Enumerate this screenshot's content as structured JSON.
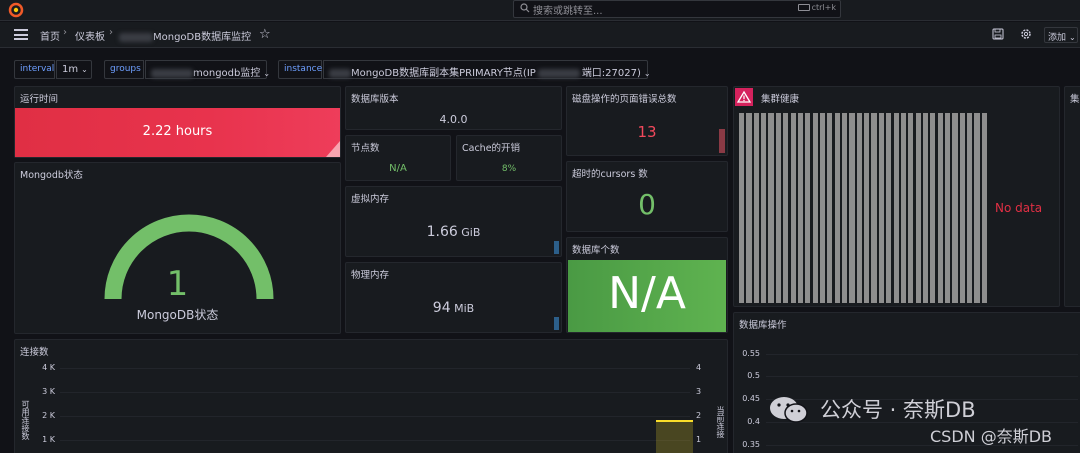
{
  "search": {
    "placeholder": "搜索或跳转至...",
    "shortcut": "ctrl+k"
  },
  "breadcrumb": {
    "home": "首页",
    "dashboards": "仪表板",
    "current": "MongoDB数据库监控"
  },
  "toolbar": {
    "add_label": "添加"
  },
  "variables": [
    {
      "label": "interval",
      "value": "1m"
    },
    {
      "label": "groups",
      "value": "mongodb监控"
    },
    {
      "label": "instance",
      "value": "MongoDB数据库副本集PRIMARY节点(IP",
      "value_suffix": "端口:27027)"
    }
  ],
  "panels": {
    "uptime": {
      "title": "运行时间",
      "value": "2.22 hours"
    },
    "db_version": {
      "title": "数据库版本",
      "value": "4.0.0"
    },
    "disk_page_faults": {
      "title": "磁盘操作的页面错误总数",
      "value": "13"
    },
    "cluster_health": {
      "title": "集群健康",
      "no_data": "No data",
      "bar_count": 34
    },
    "nodes": {
      "title": "节点数",
      "value": "N/A"
    },
    "cache_overhead": {
      "title": "Cache的开销",
      "value": "8%"
    },
    "mongodb_status": {
      "title": "Mongodb状态",
      "value": "1",
      "caption": "MongoDB状态",
      "gauge_fraction": 1.0
    },
    "virtual_mem": {
      "title": "虚拟内存",
      "value": "1.66",
      "unit": "GiB"
    },
    "cursors_timeout": {
      "title": "超时的cursors 数",
      "value": "0"
    },
    "physical_mem": {
      "title": "物理内存",
      "value": "94",
      "unit": "MiB"
    },
    "db_count": {
      "title": "数据库个数",
      "value": "N/A"
    },
    "connections": {
      "title": "连接数",
      "left_axis_label": "可用连接数",
      "right_axis_label": "当前连接",
      "left_ticks": [
        "4 K",
        "3 K",
        "2 K",
        "1 K"
      ],
      "right_ticks": [
        "4",
        "3",
        "2",
        "1"
      ]
    },
    "db_ops": {
      "title": "数据库操作",
      "ticks": [
        "0.55",
        "0.5",
        "0.45",
        "0.4",
        "0.35"
      ]
    },
    "partial_right": {
      "title": "集"
    }
  },
  "watermark": {
    "line1": "公众号 · 奈斯DB",
    "line2": "CSDN @奈斯DB"
  },
  "colors": {
    "uptime_bg": "#e02f44",
    "db_count_bg": "#56a64b",
    "green": "#73bf69",
    "red": "#f2495c",
    "link_blue": "#6e9fff"
  }
}
